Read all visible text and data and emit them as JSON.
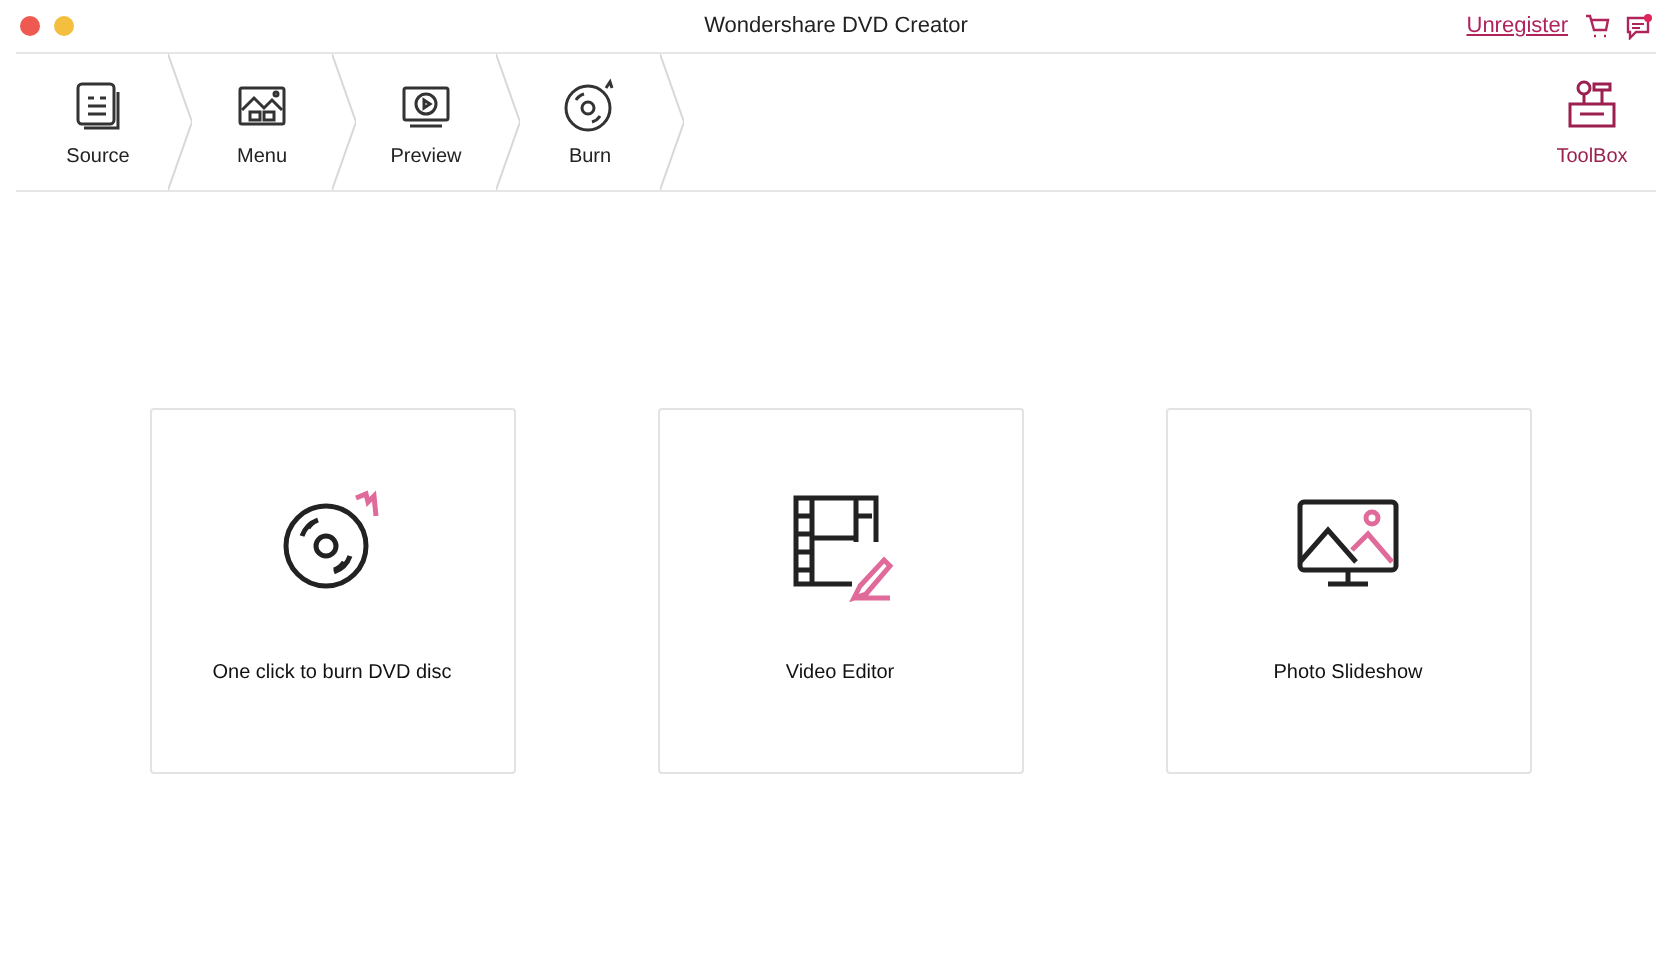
{
  "window": {
    "title": "Wondershare DVD Creator"
  },
  "header_links": {
    "unregister": "Unregister"
  },
  "steps": [
    {
      "label": "Source",
      "kind": "source"
    },
    {
      "label": "Menu",
      "kind": "menu"
    },
    {
      "label": "Preview",
      "kind": "preview"
    },
    {
      "label": "Burn",
      "kind": "burn"
    }
  ],
  "toolbox": {
    "label": "ToolBox"
  },
  "cards": [
    {
      "label": "One click to burn DVD disc",
      "kind": "burn"
    },
    {
      "label": "Video Editor",
      "kind": "editor"
    },
    {
      "label": "Photo Slideshow",
      "kind": "slideshow"
    }
  ]
}
